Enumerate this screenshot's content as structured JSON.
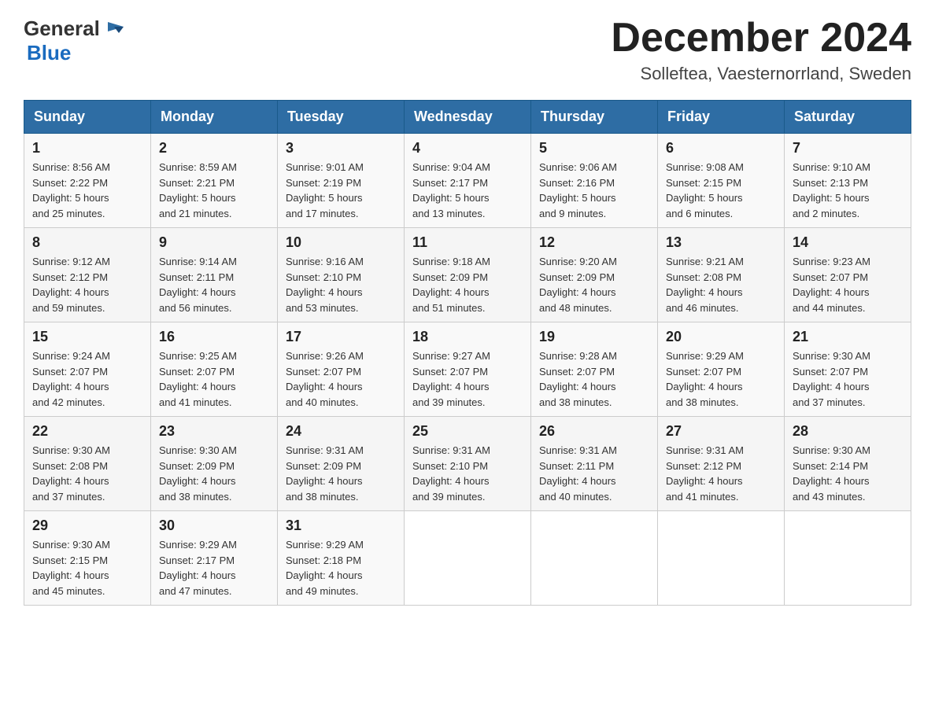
{
  "header": {
    "logo_general": "General",
    "logo_blue": "Blue",
    "month_year": "December 2024",
    "location": "Solleftea, Vaesternorrland, Sweden"
  },
  "days_of_week": [
    "Sunday",
    "Monday",
    "Tuesday",
    "Wednesday",
    "Thursday",
    "Friday",
    "Saturday"
  ],
  "weeks": [
    [
      {
        "day": "1",
        "sunrise": "8:56 AM",
        "sunset": "2:22 PM",
        "daylight": "5 hours and 25 minutes."
      },
      {
        "day": "2",
        "sunrise": "8:59 AM",
        "sunset": "2:21 PM",
        "daylight": "5 hours and 21 minutes."
      },
      {
        "day": "3",
        "sunrise": "9:01 AM",
        "sunset": "2:19 PM",
        "daylight": "5 hours and 17 minutes."
      },
      {
        "day": "4",
        "sunrise": "9:04 AM",
        "sunset": "2:17 PM",
        "daylight": "5 hours and 13 minutes."
      },
      {
        "day": "5",
        "sunrise": "9:06 AM",
        "sunset": "2:16 PM",
        "daylight": "5 hours and 9 minutes."
      },
      {
        "day": "6",
        "sunrise": "9:08 AM",
        "sunset": "2:15 PM",
        "daylight": "5 hours and 6 minutes."
      },
      {
        "day": "7",
        "sunrise": "9:10 AM",
        "sunset": "2:13 PM",
        "daylight": "5 hours and 2 minutes."
      }
    ],
    [
      {
        "day": "8",
        "sunrise": "9:12 AM",
        "sunset": "2:12 PM",
        "daylight": "4 hours and 59 minutes."
      },
      {
        "day": "9",
        "sunrise": "9:14 AM",
        "sunset": "2:11 PM",
        "daylight": "4 hours and 56 minutes."
      },
      {
        "day": "10",
        "sunrise": "9:16 AM",
        "sunset": "2:10 PM",
        "daylight": "4 hours and 53 minutes."
      },
      {
        "day": "11",
        "sunrise": "9:18 AM",
        "sunset": "2:09 PM",
        "daylight": "4 hours and 51 minutes."
      },
      {
        "day": "12",
        "sunrise": "9:20 AM",
        "sunset": "2:09 PM",
        "daylight": "4 hours and 48 minutes."
      },
      {
        "day": "13",
        "sunrise": "9:21 AM",
        "sunset": "2:08 PM",
        "daylight": "4 hours and 46 minutes."
      },
      {
        "day": "14",
        "sunrise": "9:23 AM",
        "sunset": "2:07 PM",
        "daylight": "4 hours and 44 minutes."
      }
    ],
    [
      {
        "day": "15",
        "sunrise": "9:24 AM",
        "sunset": "2:07 PM",
        "daylight": "4 hours and 42 minutes."
      },
      {
        "day": "16",
        "sunrise": "9:25 AM",
        "sunset": "2:07 PM",
        "daylight": "4 hours and 41 minutes."
      },
      {
        "day": "17",
        "sunrise": "9:26 AM",
        "sunset": "2:07 PM",
        "daylight": "4 hours and 40 minutes."
      },
      {
        "day": "18",
        "sunrise": "9:27 AM",
        "sunset": "2:07 PM",
        "daylight": "4 hours and 39 minutes."
      },
      {
        "day": "19",
        "sunrise": "9:28 AM",
        "sunset": "2:07 PM",
        "daylight": "4 hours and 38 minutes."
      },
      {
        "day": "20",
        "sunrise": "9:29 AM",
        "sunset": "2:07 PM",
        "daylight": "4 hours and 38 minutes."
      },
      {
        "day": "21",
        "sunrise": "9:30 AM",
        "sunset": "2:07 PM",
        "daylight": "4 hours and 37 minutes."
      }
    ],
    [
      {
        "day": "22",
        "sunrise": "9:30 AM",
        "sunset": "2:08 PM",
        "daylight": "4 hours and 37 minutes."
      },
      {
        "day": "23",
        "sunrise": "9:30 AM",
        "sunset": "2:09 PM",
        "daylight": "4 hours and 38 minutes."
      },
      {
        "day": "24",
        "sunrise": "9:31 AM",
        "sunset": "2:09 PM",
        "daylight": "4 hours and 38 minutes."
      },
      {
        "day": "25",
        "sunrise": "9:31 AM",
        "sunset": "2:10 PM",
        "daylight": "4 hours and 39 minutes."
      },
      {
        "day": "26",
        "sunrise": "9:31 AM",
        "sunset": "2:11 PM",
        "daylight": "4 hours and 40 minutes."
      },
      {
        "day": "27",
        "sunrise": "9:31 AM",
        "sunset": "2:12 PM",
        "daylight": "4 hours and 41 minutes."
      },
      {
        "day": "28",
        "sunrise": "9:30 AM",
        "sunset": "2:14 PM",
        "daylight": "4 hours and 43 minutes."
      }
    ],
    [
      {
        "day": "29",
        "sunrise": "9:30 AM",
        "sunset": "2:15 PM",
        "daylight": "4 hours and 45 minutes."
      },
      {
        "day": "30",
        "sunrise": "9:29 AM",
        "sunset": "2:17 PM",
        "daylight": "4 hours and 47 minutes."
      },
      {
        "day": "31",
        "sunrise": "9:29 AM",
        "sunset": "2:18 PM",
        "daylight": "4 hours and 49 minutes."
      },
      null,
      null,
      null,
      null
    ]
  ],
  "labels": {
    "sunrise": "Sunrise:",
    "sunset": "Sunset:",
    "daylight": "Daylight:"
  }
}
